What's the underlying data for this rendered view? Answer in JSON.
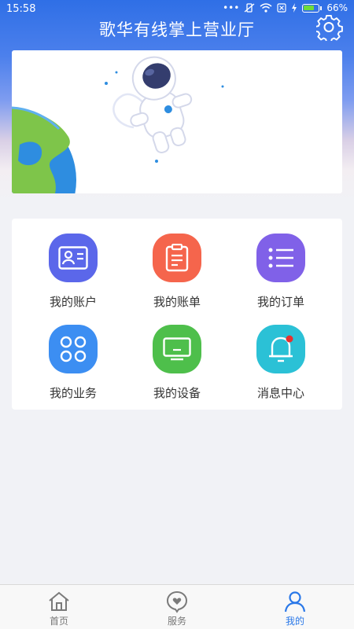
{
  "status_bar": {
    "time": "15:58",
    "battery": "66%"
  },
  "header": {
    "title": "歌华有线掌上营业厅"
  },
  "menu": [
    {
      "label": "我的账户",
      "color": "#5b67ea",
      "icon": "id-card-icon"
    },
    {
      "label": "我的账单",
      "color": "#f5654c",
      "icon": "bill-icon"
    },
    {
      "label": "我的订单",
      "color": "#8061e8",
      "icon": "order-list-icon"
    },
    {
      "label": "我的业务",
      "color": "#3c8ef2",
      "icon": "apps-grid-icon"
    },
    {
      "label": "我的设备",
      "color": "#4ebf4b",
      "icon": "tv-icon"
    },
    {
      "label": "消息中心",
      "color": "#2bc1d6",
      "icon": "bell-icon"
    }
  ],
  "tabbar": {
    "items": [
      {
        "label": "首页",
        "icon": "home-icon"
      },
      {
        "label": "服务",
        "icon": "service-icon"
      },
      {
        "label": "我的",
        "icon": "user-icon"
      }
    ],
    "active": "我的",
    "accent": "#2a78e8"
  }
}
